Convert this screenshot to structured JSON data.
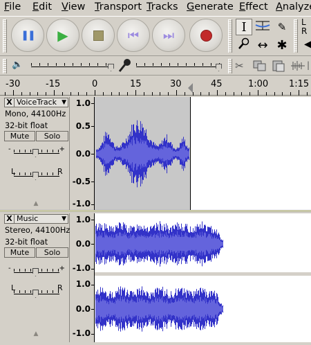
{
  "menu": [
    "File",
    "Edit",
    "View",
    "Transport",
    "Tracks",
    "Generate",
    "Effect",
    "Analyze"
  ],
  "transport": {
    "buttons": [
      {
        "name": "pause-button",
        "glyph": "❚❚",
        "color": "#3a6fd8"
      },
      {
        "name": "play-button",
        "glyph": "▶",
        "color": "#3cb043"
      },
      {
        "name": "stop-button",
        "glyph": "■",
        "color": "#a09868"
      },
      {
        "name": "skip-start-button",
        "glyph": "⏮",
        "color": "#9d8ce0"
      },
      {
        "name": "skip-end-button",
        "glyph": "⏭",
        "color": "#9d8ce0"
      },
      {
        "name": "record-button",
        "glyph": "●",
        "color": "#c22a2a"
      }
    ]
  },
  "tools": {
    "selection": "I",
    "envelope": "≚",
    "draw": "✎",
    "zoom": "🔍",
    "timeshift": "↔",
    "multi": "✱",
    "meter_l": "L",
    "meter_r": "R"
  },
  "mixer": {
    "speaker_icon": "speaker-icon",
    "mic_icon": "microphone-icon"
  },
  "ruler": {
    "labels": [
      "-30",
      "-15",
      "0",
      "15",
      "30",
      "45",
      "1:00",
      "1:15"
    ]
  },
  "tracks": [
    {
      "name": "VoiceTrack",
      "info1": "Mono, 44100Hz",
      "info2": "32-bit float",
      "mute": "Mute",
      "solo": "Solo",
      "pan_left": "L",
      "pan_right": "R",
      "close": "X",
      "scale": [
        "1.0",
        "0.5",
        "0.0",
        "-0.5",
        "-1.0"
      ]
    },
    {
      "name": "Music",
      "info1": "Stereo, 44100Hz",
      "info2": "32-bit float",
      "mute": "Mute",
      "solo": "Solo",
      "pan_left": "L",
      "pan_right": "R",
      "close": "X",
      "scale_top": [
        "1.0",
        "0.0",
        "-1.0"
      ],
      "scale_bottom": [
        "1.0",
        "0.0",
        "-1.0"
      ]
    }
  ],
  "colors": {
    "waveform": "#3232c8",
    "waveform_rms": "#6464dc",
    "selection": "#c8c8c8",
    "bg": "#ffffff"
  }
}
